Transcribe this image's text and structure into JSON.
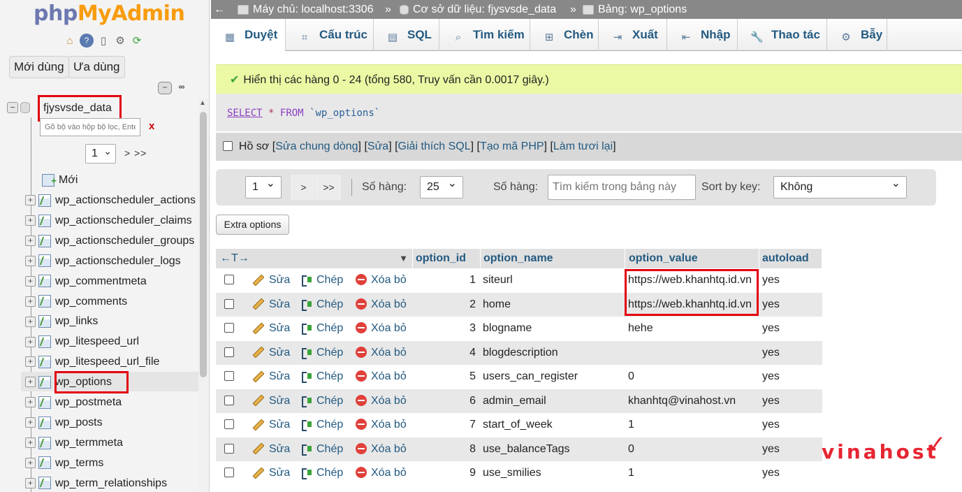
{
  "nav": {
    "logo_php": "php",
    "logo_myadmin": "MyAdmin",
    "recent_label": "Mới dùng",
    "favorites_label": "Ưa dùng",
    "db_name": "fjysvsde_data",
    "filter_placeholder": "Gõ bộ vào hộp bộ lọc, Enter để tìm",
    "filter_clear": "x",
    "page_select": "1",
    "page_next": "> >>",
    "new_label": "Mới",
    "tables": [
      "wp_actionscheduler_actions",
      "wp_actionscheduler_claims",
      "wp_actionscheduler_groups",
      "wp_actionscheduler_logs",
      "wp_commentmeta",
      "wp_comments",
      "wp_links",
      "wp_litespeed_url",
      "wp_litespeed_url_file",
      "wp_options",
      "wp_postmeta",
      "wp_posts",
      "wp_termmeta",
      "wp_terms",
      "wp_term_relationships"
    ],
    "selected_table": "wp_options"
  },
  "breadcrumb": {
    "back": "←",
    "server": "Máy chủ: localhost:3306",
    "sep": "»",
    "database": "Cơ sở dữ liệu: fjysvsde_data",
    "table": "Bảng: wp_options"
  },
  "tabs": [
    {
      "label": "Duyệt",
      "icon": "▦",
      "active": true
    },
    {
      "label": "Cấu trúc",
      "icon": "⌗",
      "active": false
    },
    {
      "label": "SQL",
      "icon": "▤",
      "active": false
    },
    {
      "label": "Tìm kiếm",
      "icon": "⌕",
      "active": false
    },
    {
      "label": "Chèn",
      "icon": "⊞",
      "active": false
    },
    {
      "label": "Xuất",
      "icon": "⇥",
      "active": false
    },
    {
      "label": "Nhập",
      "icon": "⇤",
      "active": false
    },
    {
      "label": "Thao tác",
      "icon": "🔧",
      "active": false
    },
    {
      "label": "Bẫy",
      "icon": "⚙",
      "active": false
    }
  ],
  "notice": "Hiển thị các hàng 0 - 24 (tổng 580, Truy vấn cần 0.0017 giây.)",
  "sql": {
    "select": "SELECT",
    "star": "*",
    "from": "FROM",
    "table": "`wp_options`"
  },
  "profile": {
    "label": "Hồ sơ",
    "open": "[",
    "close": "]",
    "links": [
      "Sửa chung dòng",
      "Sửa",
      "Giải thích SQL",
      "Tạo mã PHP",
      "Làm tươi lại"
    ]
  },
  "navbar": {
    "page": "1",
    "next": ">",
    "last": ">>",
    "rows_label": "Số hàng:",
    "rows_value": "25",
    "search_label": "Số hàng:",
    "search_placeholder": "Tìm kiếm trong bảng này",
    "sort_label": "Sort by key:",
    "sort_value": "Không"
  },
  "extra_options": "Extra options",
  "table": {
    "arrows": "←T→",
    "columns": [
      "option_id",
      "option_name",
      "option_value",
      "autoload"
    ],
    "edit": "Sửa",
    "copy": "Chép",
    "delete": "Xóa bỏ",
    "rows": [
      {
        "id": "1",
        "name": "siteurl",
        "value": "https://web.khanhtq.id.vn",
        "autoload": "yes"
      },
      {
        "id": "2",
        "name": "home",
        "value": "https://web.khanhtq.id.vn",
        "autoload": "yes"
      },
      {
        "id": "3",
        "name": "blogname",
        "value": "hehe",
        "autoload": "yes"
      },
      {
        "id": "4",
        "name": "blogdescription",
        "value": "",
        "autoload": "yes"
      },
      {
        "id": "5",
        "name": "users_can_register",
        "value": "0",
        "autoload": "yes"
      },
      {
        "id": "6",
        "name": "admin_email",
        "value": "khanhtq@vinahost.vn",
        "autoload": "yes"
      },
      {
        "id": "7",
        "name": "start_of_week",
        "value": "1",
        "autoload": "yes"
      },
      {
        "id": "8",
        "name": "use_balanceTags",
        "value": "0",
        "autoload": "yes"
      },
      {
        "id": "9",
        "name": "use_smilies",
        "value": "1",
        "autoload": "yes"
      }
    ]
  },
  "watermark": "vinahost",
  "colors": {
    "accent": "#235a81",
    "highlight": "#e3000f",
    "notice_bg": "#ebf8a4"
  }
}
